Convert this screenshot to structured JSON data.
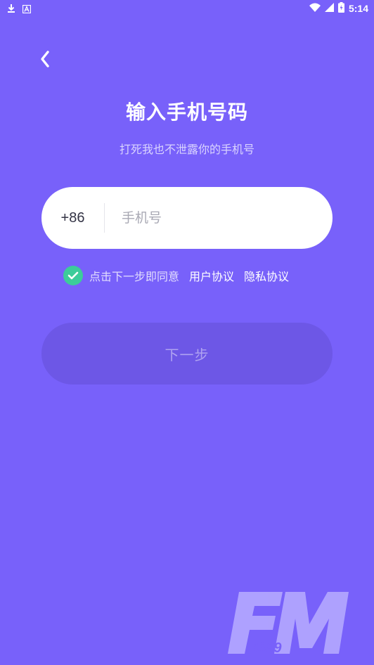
{
  "status_bar": {
    "time": "5:14",
    "icons": [
      "download-icon",
      "a-notification-icon",
      "wifi-icon",
      "signal-icon",
      "battery-icon"
    ]
  },
  "header": {
    "back_icon": "chevron-left-icon",
    "title": "输入手机号码",
    "subtitle": "打死我也不泄露你的手机号"
  },
  "phone_form": {
    "country_code": "+86",
    "phone_value": "",
    "phone_placeholder": "手机号"
  },
  "agreement": {
    "checked": true,
    "check_icon": "check-icon",
    "text": "点击下一步即同意",
    "user_agreement": "用户协议",
    "privacy_policy": "隐私协议"
  },
  "next_button": {
    "label": "下一步",
    "enabled": false
  },
  "watermark": {
    "logo_text": "FM",
    "logo_number": "4399"
  },
  "colors": {
    "background": "#7861fa",
    "button_disabled": "#6d57e6",
    "check_green": "#3ccc9a",
    "input_bg": "#ffffff"
  }
}
